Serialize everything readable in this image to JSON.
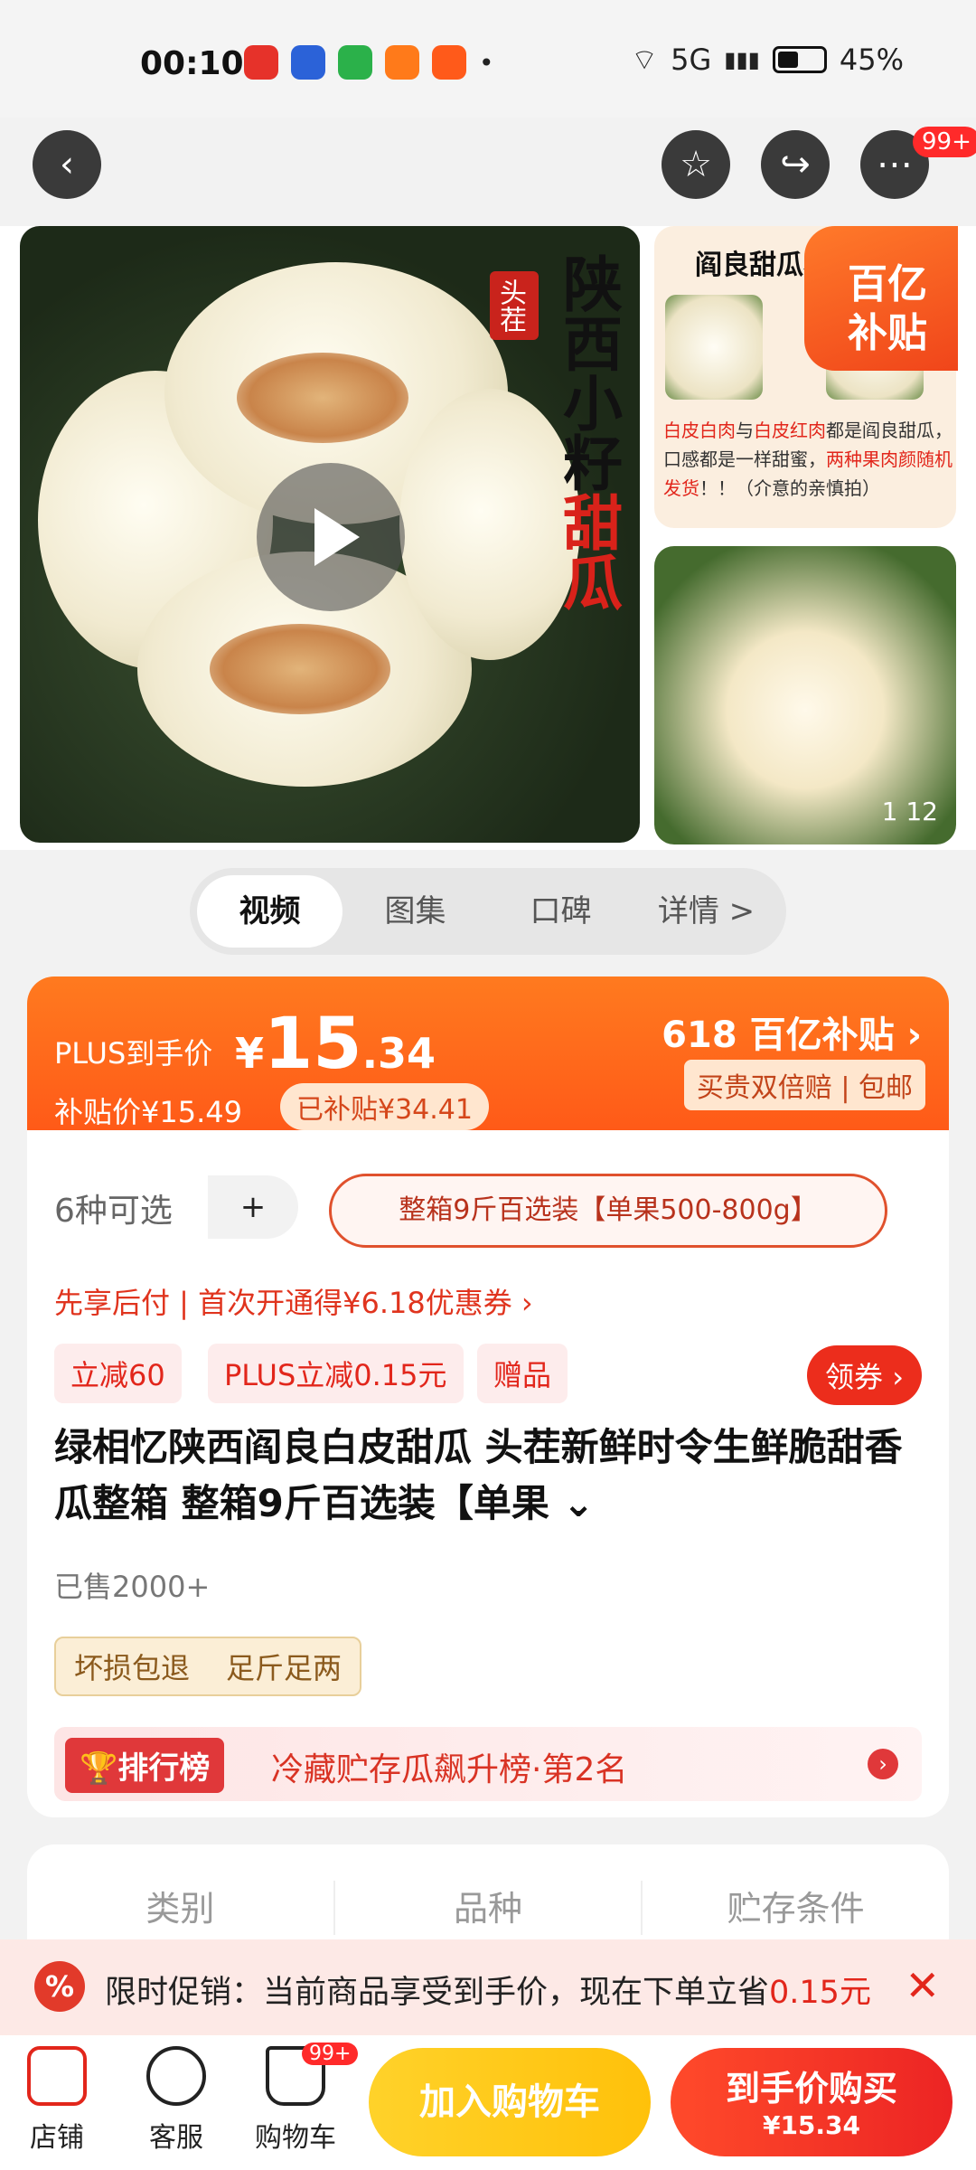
{
  "status_bar": {
    "time": "00:10",
    "network": "5G",
    "battery": "45%"
  },
  "nav": {
    "badge": "99+"
  },
  "gallery": {
    "main_stamp": "头茬",
    "main_title_black": "陕西小籽",
    "main_title_red": "甜瓜",
    "side_heading": "阎良甜瓜小",
    "subsidy_badge_line1": "百亿",
    "subsidy_badge_line2": "补贴",
    "side_note_1": "白皮白肉",
    "side_note_2": "与",
    "side_note_3": "白皮红肉",
    "side_note_4": "都是阎良甜瓜，口感都是一样甜蜜，",
    "side_note_5": "两种果肉颜随机发货",
    "side_note_6": "！！（介意的亲慎拍）",
    "counter": "1    12"
  },
  "tabs": [
    {
      "label": "视频"
    },
    {
      "label": "图集"
    },
    {
      "label": "口碑"
    },
    {
      "label": "详情 >"
    }
  ],
  "price": {
    "plus_label": "PLUS到手价",
    "currency": "¥",
    "integer": "15",
    "decimal": ".34",
    "subsidy_price": "补贴价¥15.49",
    "subsidized": "已补贴¥34.41",
    "promo_618": "618 百亿补贴 ›",
    "guarantee": "买贵双倍赔 | 包邮"
  },
  "options": {
    "count": "6种可选",
    "plus": "+",
    "selected": "整箱9斤百选装【单果500-800g】"
  },
  "promo_line": "先享后付 | 首次开通得¥6.18优惠券 ›",
  "tags": [
    "立减60",
    "PLUS立减0.15元",
    "赠品"
  ],
  "coupon": "领券 ›",
  "product_title": "绿相忆陕西阎良白皮甜瓜 头茬新鲜时令生鲜脆甜香瓜整箱 整箱9斤百选装【单果 ⌄",
  "sold": "已售2000+",
  "guarantee_tags": [
    "坏损包退",
    "足斤足两"
  ],
  "rank": {
    "label": "排行榜",
    "text": "冷藏贮存瓜飙升榜·第2名",
    "arrow": "›"
  },
  "specs": [
    "类别",
    "品种",
    "贮存条件"
  ],
  "promo_banner": {
    "icon": "%",
    "text": "限时促销：当前商品享受到手价，现在下单立省",
    "amount": "0.15元",
    "close": "✕"
  },
  "bottom": {
    "store": "店铺",
    "service": "客服",
    "cart": "购物车",
    "cart_badge": "99+",
    "add_cart": "加入购物车",
    "buy_line1": "到手价购买",
    "buy_line2": "¥15.34"
  },
  "colors": {
    "accent": "#ff5a18",
    "red": "#e2261b",
    "yellow": "#ffc10a"
  }
}
